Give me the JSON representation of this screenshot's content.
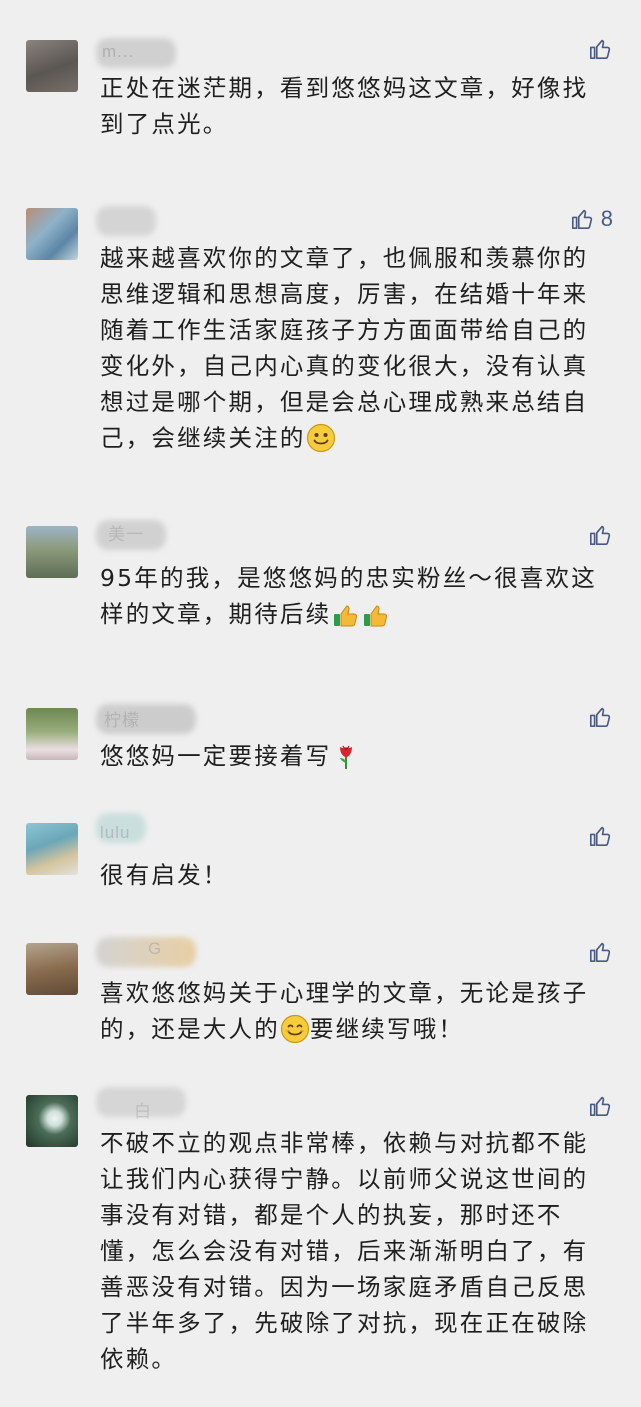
{
  "comments": [
    {
      "name": "m...",
      "likes": "",
      "text": "正处在迷茫期，看到悠悠妈这文章，好像找到了点光。",
      "colors": {
        "avatar": "#6e6a66",
        "avatar2": "#8d8680",
        "blur": "#c9c9c9"
      }
    },
    {
      "name": "",
      "likes": "8",
      "text": "越来越喜欢你的文章了，也佩服和羡慕你的思维逻辑和思想高度，厉害，在结婚十年来随着工作生活家庭孩子方方面面带给自己的变化外，自己内心真的变化很大，没有认真想过是哪个期，但是会总心理成熟来总结自己，会继续关注的",
      "emoji": "smile",
      "colors": {
        "avatar": "#6f9ab8",
        "avatar2": "#c9a286",
        "blur": "#cfcfcf"
      }
    },
    {
      "name": "美一",
      "likes": "",
      "text": "95年的我，是悠悠妈的忠实粉丝～很喜欢这样的文章，期待后续",
      "emoji": "thumbs",
      "colors": {
        "avatar": "#7f8f7a",
        "avatar2": "#a9b5c1",
        "blur": "#cfcfcf"
      }
    },
    {
      "name": "柠檬",
      "likes": "",
      "text": "悠悠妈一定要接着写",
      "emoji": "rose",
      "colors": {
        "avatar": "#7c8f62",
        "avatar2": "#e7d5d8",
        "blur": "#cacaca"
      }
    },
    {
      "name": "lulu",
      "likes": "",
      "text": "很有启发！",
      "colors": {
        "avatar": "#7fb7c7",
        "avatar2": "#d9c8a6",
        "blur": "#bfd9d8"
      }
    },
    {
      "name": "G",
      "likes": "",
      "text": "喜欢悠悠妈关于心理学的文章，无论是孩子的，还是大人的",
      "text_after": "要继续写哦！",
      "emoji": "smile",
      "colors": {
        "avatar": "#8a6c4e",
        "avatar2": "#b2a18a",
        "blur": "#e3c79b"
      }
    },
    {
      "name": "白",
      "likes": "",
      "text": "不破不立的观点非常棒，依赖与对抗都不能让我们内心获得宁静。以前师父说这世间的事没有对错，都是个人的执妄，那时还不懂，怎么会没有对错，后来渐渐明白了，有善恶没有对错。因为一场家庭矛盾自己反思了半年多了，先破除了对抗，现在正在破除依赖。",
      "colors": {
        "avatar": "#2f4c3a",
        "avatar2": "#e9f2f0",
        "blur": "#d2d2d2"
      }
    }
  ],
  "icons": {
    "like": "thumbs-up-outline-icon"
  },
  "theme": {
    "background": "#efefef",
    "like_color": "#4a5a82",
    "text_color": "#1f1f1f"
  }
}
